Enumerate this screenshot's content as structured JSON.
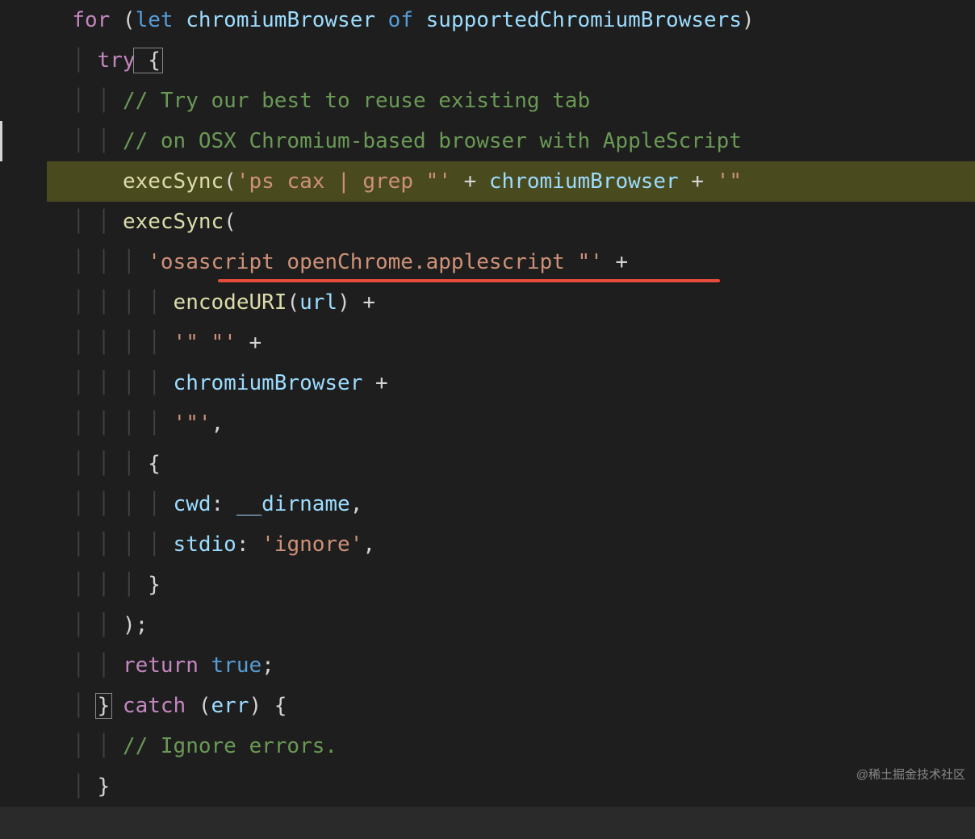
{
  "code": {
    "line1": {
      "for": "for",
      "paren_open": " (",
      "let": "let",
      "var1": " chromiumBrowser ",
      "of": "of",
      "var2": " supportedChromiumBrowsers",
      "paren_close": ")"
    },
    "line2": {
      "try": "try",
      "brace": " {"
    },
    "line3": {
      "comment": "// Try our best to reuse existing tab"
    },
    "line4": {
      "comment": "// on OSX Chromium-based browser with AppleScript"
    },
    "line5": {
      "func": "execSync",
      "paren": "(",
      "str1": "'ps cax | grep \"'",
      "plus1": " + ",
      "var": "chromiumBrowser",
      "plus2": " + ",
      "str2": "'\""
    },
    "line6": {
      "func": "execSync",
      "paren": "("
    },
    "line7": {
      "str": "'osascript openChrome.applescript \"'",
      "plus": " +"
    },
    "line8": {
      "func": "encodeURI",
      "paren_open": "(",
      "var": "url",
      "paren_close": ")",
      "plus": " +"
    },
    "line9": {
      "str": "'\" \"'",
      "plus": " +"
    },
    "line10": {
      "var": "chromiumBrowser",
      "plus": " +"
    },
    "line11": {
      "str": "'\"'",
      "comma": ","
    },
    "line12": {
      "brace": "{"
    },
    "line13": {
      "key": "cwd",
      "colon": ": ",
      "val": "__dirname",
      "comma": ","
    },
    "line14": {
      "key": "stdio",
      "colon": ": ",
      "val": "'ignore'",
      "comma": ","
    },
    "line15": {
      "brace": "}"
    },
    "line16": {
      "close": ");"
    },
    "line17": {
      "return": "return",
      "true": " true",
      "semi": ";"
    },
    "line18": {
      "close_brace": "}",
      "catch": " catch ",
      "paren_open": "(",
      "err": "err",
      "paren_close": ")",
      "open_brace": " {"
    },
    "line19": {
      "comment": "// Ignore errors."
    },
    "line20": {
      "brace": "}"
    }
  },
  "watermark": "@稀土掘金技术社区"
}
